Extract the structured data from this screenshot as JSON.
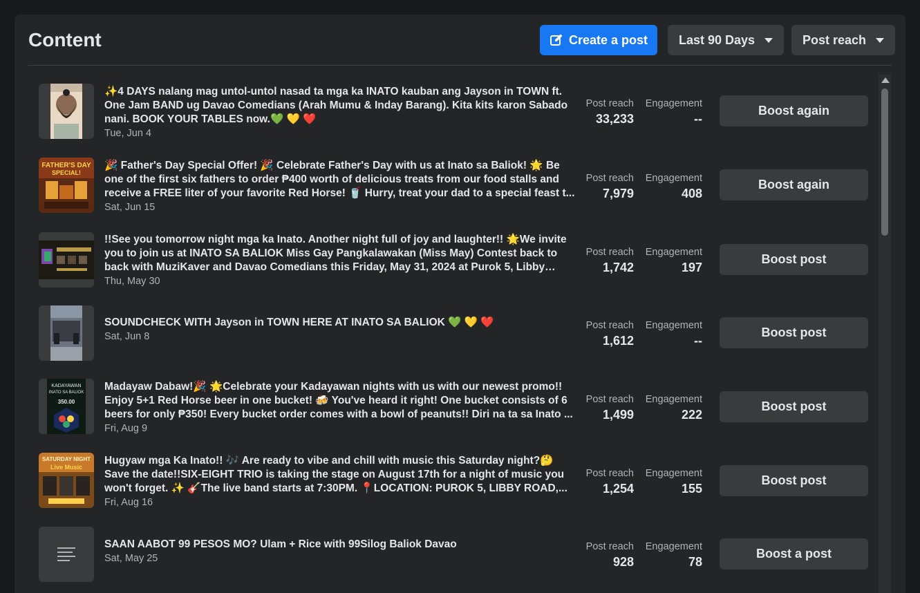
{
  "header": {
    "title": "Content",
    "create_label": "Create a post",
    "range_label": "Last 90 Days",
    "metric_label": "Post reach"
  },
  "posts": [
    {
      "text": "✨4 DAYS nalang mag untol-untol nasad ta mga ka INATO kauban ang Jayson in TOWN ft. One Jam BAND ug Davao Comedians (Arah Mumu & Inday Barang). Kita kits karon Sabado nani. BOOK YOUR TABLES now.💚 💛 ❤️",
      "date": "Tue, Jun 4",
      "reach_label": "Post reach",
      "reach": "33,233",
      "engagement_label": "Engagement",
      "engagement": "--",
      "action": "Boost again",
      "thumb": "portrait-photo"
    },
    {
      "text": "🎉 Father's Day Special Offer! 🎉 Celebrate Father's Day with us at Inato sa Baliok! 🌟 Be one of the first six fathers to order ₱400 worth of delicious treats from our food stalls and receive a FREE liter of your favorite Red Horse! 🥤 Hurry, treat your dad to a special feast t...",
      "date": "Sat, Jun 15",
      "reach_label": "Post reach",
      "reach": "7,979",
      "engagement_label": "Engagement",
      "engagement": "408",
      "action": "Boost again",
      "thumb": "fathers-day-poster"
    },
    {
      "text": "!!See you tomorrow night mga ka Inato. Another night full of joy and laughter!! 🌟We invite you to join us at INATO SA BALIOK Miss Gay Pangkalawakan (Miss May) Contest back to back with MuziKaver and Davao Comedians this Friday, May 31, 2024 at Purok 5, Libby Roa...",
      "date": "Thu, May 30",
      "reach_label": "Post reach",
      "reach": "1,742",
      "engagement_label": "Engagement",
      "engagement": "197",
      "action": "Boost post",
      "thumb": "event-poster"
    },
    {
      "text": "SOUNDCHECK WITH Jayson in TOWN HERE AT INATO SA BALIOK 💚 💛 ❤️",
      "date": "Sat, Jun 8",
      "reach_label": "Post reach",
      "reach": "1,612",
      "engagement_label": "Engagement",
      "engagement": "--",
      "action": "Boost post",
      "thumb": "stage-photo"
    },
    {
      "text": "Madayaw Dabaw!🎉 🌟Celebrate your Kadayawan nights with us with our newest promo!! Enjoy 5+1 Red Horse beer in one bucket! 🍻 You've heard it right! One bucket consists of 6 beers for only ₱350! Every bucket order comes with a bowl of peanuts!! Diri na ta sa Inato ...",
      "date": "Fri, Aug 9",
      "reach_label": "Post reach",
      "reach": "1,499",
      "engagement_label": "Engagement",
      "engagement": "222",
      "action": "Boost post",
      "thumb": "promo-poster"
    },
    {
      "text": "Hugyaw mga Ka Inato!! 🎶 Are ready to vibe and chill with music this Saturday night?🤔 Save the date!!SIX-EIGHT TRIO is taking the stage on August 17th for a night of music you won't forget. ✨ 🎸The live band starts at 7:30PM. 📍LOCATION: PUROK 5, LIBBY ROAD,...",
      "date": "Fri, Aug 16",
      "reach_label": "Post reach",
      "reach": "1,254",
      "engagement_label": "Engagement",
      "engagement": "155",
      "action": "Boost post",
      "thumb": "live-music-poster"
    },
    {
      "text": "SAAN AABOT 99 PESOS MO? Ulam + Rice with 99Silog Baliok Davao",
      "date": "Sat, May 25",
      "reach_label": "Post reach",
      "reach": "928",
      "engagement_label": "Engagement",
      "engagement": "78",
      "action": "Boost a post",
      "thumb": "text-lines-icon"
    }
  ]
}
